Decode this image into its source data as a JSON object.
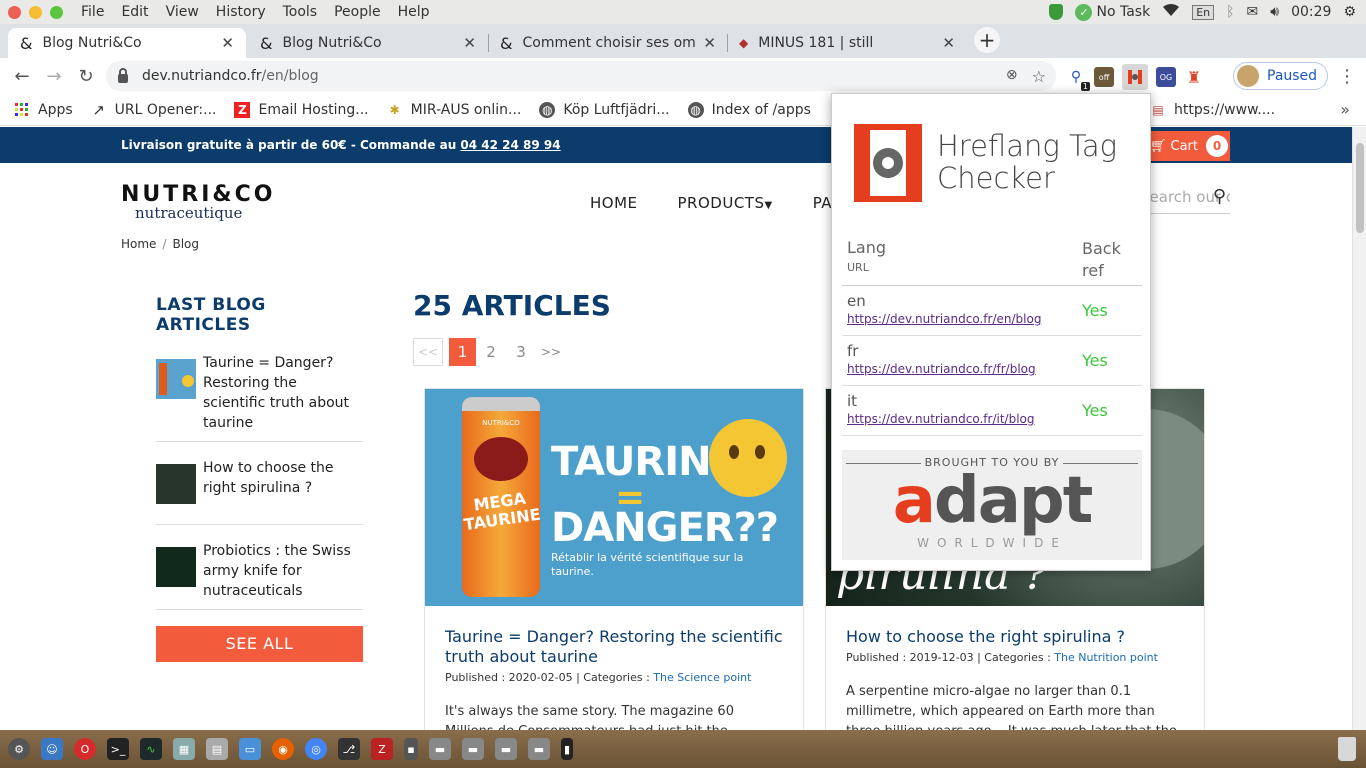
{
  "os": {
    "menu": [
      "File",
      "Edit",
      "View",
      "History",
      "Tools",
      "People",
      "Help"
    ],
    "task_label": "No Task",
    "lang": "En",
    "clock": "00:29"
  },
  "tabs": [
    {
      "label": "Blog Nutri&Co",
      "active": true
    },
    {
      "label": "Blog Nutri&Co",
      "active": false
    },
    {
      "label": "Comment choisir ses omé",
      "active": false
    },
    {
      "label": "MINUS 181 | still",
      "active": false
    }
  ],
  "address": {
    "host": "dev.nutriandco.fr",
    "path": "/en/blog"
  },
  "extensions": {
    "badge_count": "1",
    "off_label": "off",
    "paused_label": "Paused"
  },
  "bookmarks": [
    {
      "label": "Apps",
      "icon": "apps-grid-icon"
    },
    {
      "label": "URL Opener:...",
      "icon": "external-link-icon"
    },
    {
      "label": "Email Hosting...",
      "icon": "zoho-icon"
    },
    {
      "label": "MIR-AUS onlin...",
      "icon": "butterfly-icon"
    },
    {
      "label": "Köp Luftfjädri...",
      "icon": "globe-icon"
    },
    {
      "label": "Index of /apps",
      "icon": "globe-icon"
    },
    {
      "label": "https://www....",
      "icon": "page-icon"
    }
  ],
  "site": {
    "promo": "Livraison gratuite à partir de 60€ - Commande au ",
    "phone": "04 42 24 89 94",
    "cart_label": "Cart",
    "cart_count": "0",
    "logo_main": "NUTRI&CO",
    "logo_sub": "nutraceutique",
    "nav": [
      "HOME",
      "PRODUCTS",
      "PAC"
    ],
    "search_placeholder": "Search our cata",
    "breadcrumb": [
      "Home",
      "Blog"
    ],
    "sidebar_title_1": "LAST BLOG",
    "sidebar_title_2": "ARTICLES",
    "sidebar_items": [
      "Taurine = Danger? Restoring the scientific truth about taurine",
      "How to choose the right spirulina ?",
      "Probiotics : the Swiss army knife for nutraceuticals"
    ],
    "see_all": "SEE ALL",
    "articles_heading": "25 ARTICLES",
    "pager": {
      "prev": "<<",
      "pages": [
        "1",
        "2",
        "3"
      ],
      "next": ">>",
      "current": "1"
    },
    "cards": [
      {
        "title": "Taurine = Danger? Restoring the scientific truth about taurine",
        "published": "Published : 2020-02-05 | Categories : ",
        "category": "The Science point",
        "excerpt": "It's always the same story. The magazine 60 Millions de Consommateurs had just hit the headlines with a",
        "img_text_1": "TAURINE",
        "img_text_2": "=",
        "img_text_3": "DANGER??",
        "img_sub": "Rétablir la vérité scientifique sur la taurine.",
        "can_brand": "NUTRI&CO",
        "can_name_1": "MEGA",
        "can_name_2": "TAURINE"
      },
      {
        "title": "How to choose the right spirulina ?",
        "published": "Published : 2019-12-03 | Categories : ",
        "category": "The Nutrition point",
        "excerpt": "A serpentine micro-algae no larger than 0.1 millimetre, which appeared on Earth more than three billion years ago... It was much later that the Aztecs and tribes",
        "img_text_1": "pirulina ?"
      }
    ]
  },
  "popup": {
    "title_1": "Hreflang Tag",
    "title_2": "Checker",
    "head_lang": "Lang",
    "head_url": "URL",
    "head_back_1": "Back",
    "head_back_2": "ref",
    "rows": [
      {
        "lang": "en",
        "url": "https://dev.nutriandco.fr/en/blog",
        "backref": "Yes"
      },
      {
        "lang": "fr",
        "url": "https://dev.nutriandco.fr/fr/blog",
        "backref": "Yes"
      },
      {
        "lang": "it",
        "url": "https://dev.nutriandco.fr/it/blog",
        "backref": "Yes"
      }
    ],
    "brought_by": "BROUGHT TO YOU BY",
    "brand": "adapt",
    "brand_sub": "WORLDWIDE"
  }
}
